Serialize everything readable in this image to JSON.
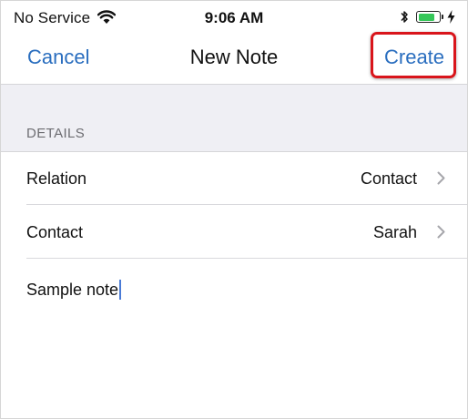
{
  "status_bar": {
    "carrier": "No Service",
    "time": "9:06 AM",
    "wifi_icon": "wifi-icon",
    "bluetooth_icon": "bluetooth-icon",
    "battery_level": 0.85,
    "battery_color": "#35c759",
    "charging_icon": "bolt-icon"
  },
  "nav": {
    "cancel_label": "Cancel",
    "title": "New Note",
    "create_label": "Create",
    "highlight_color": "#d9151b",
    "accent_color": "#2a6ebf"
  },
  "section": {
    "title": "DETAILS"
  },
  "rows": [
    {
      "label": "Relation",
      "value": "Contact"
    },
    {
      "label": "Contact",
      "value": "Sarah"
    }
  ],
  "note": {
    "text": "Sample note"
  }
}
